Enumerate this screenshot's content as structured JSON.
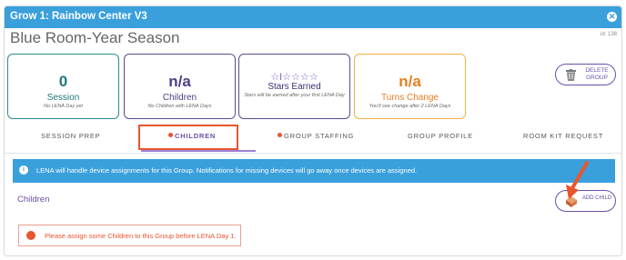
{
  "window": {
    "title": "Grow 1: Rainbow Center V3",
    "close_icon": "close-icon"
  },
  "group": {
    "name": "Blue Room-Year Season",
    "id_label": "id: 138"
  },
  "stats": {
    "session": {
      "value": "0",
      "label": "Session",
      "sub": "No LENA Day yet"
    },
    "children": {
      "value": "n/a",
      "label": "Children",
      "sub": "No Children with LENA Days"
    },
    "stars": {
      "icons": "☆I☆☆☆☆",
      "label": "Stars Earned",
      "sub": "Stars will be earned after your first LENA Day"
    },
    "turns": {
      "value": "n/a",
      "label": "Turns Change",
      "sub": "You'll see change after 2 LENA Days"
    }
  },
  "delete_button": {
    "label": "DELETE GROUP",
    "icon": "trash-icon"
  },
  "tabs": [
    {
      "label": "SESSION PREP",
      "dot": false
    },
    {
      "label": "CHILDREN",
      "dot": true,
      "active": true
    },
    {
      "label": "GROUP STAFFING",
      "dot": true
    },
    {
      "label": "GROUP PROFILE",
      "dot": false
    },
    {
      "label": "ROOM KIT REQUEST",
      "dot": false
    }
  ],
  "info_banner": {
    "icon": "info-icon",
    "text": "LENA will handle device assignments for this Group. Notifications for missing devices will go away once devices are assigned."
  },
  "children_section": {
    "title": "Children",
    "add_button": {
      "label": "ADD CHILD",
      "icon": "child-block-icon"
    },
    "warning": "Please assign some Children to this Group before LENA Day 1."
  },
  "colors": {
    "brand_blue": "#3aa0dc",
    "purple": "#6b4fa8",
    "teal": "#1d7a7a",
    "orange": "#e67e22",
    "alert": "#e8552e"
  }
}
